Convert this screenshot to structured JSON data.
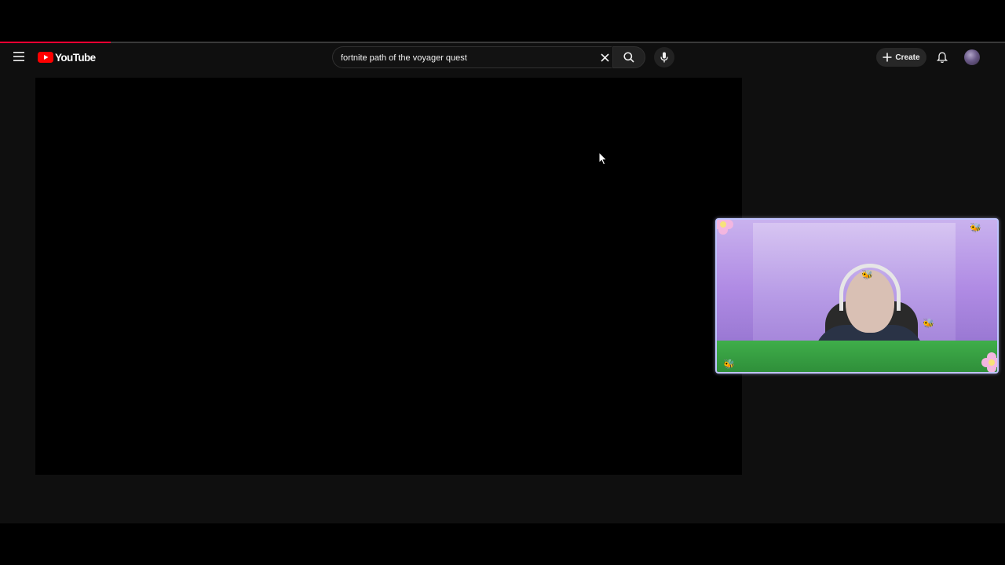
{
  "app": {
    "logo_text": "YouTube",
    "brand_color": "#ff0000",
    "load_progress": 0.11
  },
  "search": {
    "value": "fortnite path of the voyager quest",
    "placeholder": "Search"
  },
  "header": {
    "create_label": "Create"
  },
  "icons": {
    "menu": "menu-icon",
    "search": "search-icon",
    "clear": "close-icon",
    "mic": "microphone-icon",
    "create": "plus-icon",
    "notifications": "bell-icon"
  },
  "colors": {
    "background": "#0f0f0f",
    "accent": "#ff0033",
    "webcam_border": "#bfc4ff"
  }
}
